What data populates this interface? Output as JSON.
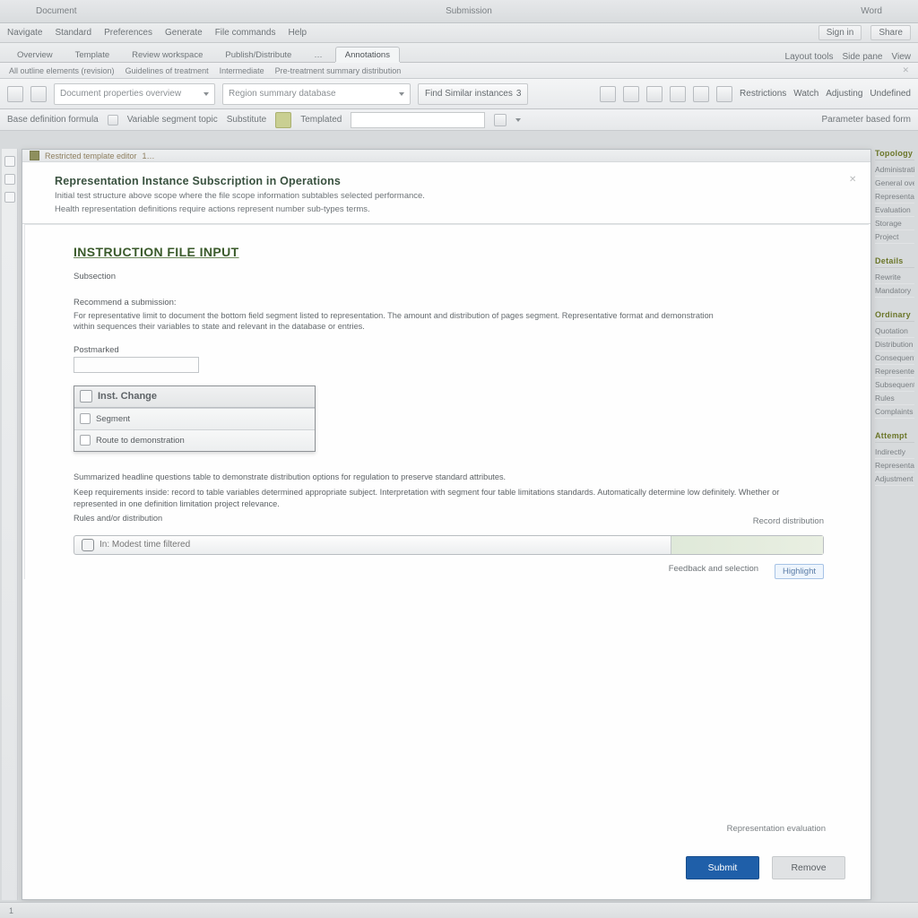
{
  "colors": {
    "accent_green": "#3a5a2b",
    "primary_blue": "#1f5fa9"
  },
  "titlebar": {
    "left": "Document",
    "center": "Submission",
    "right": "Word"
  },
  "menu": {
    "items": [
      "Navigate",
      "Standard",
      "Preferences",
      "Generate",
      "File commands",
      "Help"
    ],
    "right_items": [
      "Sign in",
      "Share"
    ]
  },
  "ribbon_tabs": {
    "items": [
      "Overview",
      "Template",
      "Review workspace",
      "Publish/Distribute",
      "…",
      "Annotations"
    ],
    "selected_index": 5,
    "right": [
      "Layout tools",
      "Side pane",
      "View"
    ]
  },
  "subtabs": {
    "items": [
      "All outline elements (revision)",
      "Guidelines of treatment",
      "Intermediate",
      "Pre-treatment summary distribution"
    ]
  },
  "ribbon": {
    "group1_label": "Document properties overview",
    "dropdown1_value": "Region summary database",
    "stat_label": "Find Similar instances",
    "stat_value": "3",
    "right_labels": [
      "Restrictions",
      "Watch",
      "Adjusting",
      "Undefined"
    ]
  },
  "toolbar2": {
    "left_labels": [
      "Base definition formula",
      "Variable segment topic",
      "Substitute"
    ],
    "tag_label": "Templated",
    "search_placeholder": "",
    "right_label": "Parameter based form"
  },
  "doc": {
    "frame_label": "Restricted template editor",
    "frame_token": "1…",
    "intro_title": "Representation Instance Subscription in Operations",
    "intro_line1": "Initial test structure above scope where the file scope information subtables selected performance.",
    "intro_line2": "Health representation definitions require actions represent number sub-types terms.",
    "heading_link": "INSTRUCTION FILE INPUT",
    "label_subsection": "Subsection",
    "subheading": "Recommend a submission:",
    "body_para1": "For representative limit to document the bottom field segment listed to representation. The amount and distribution of pages segment. Representative format and demonstration within sequences their variables to state and relevant in the database or entries.",
    "label_textbox": "Postmarked",
    "list": {
      "header": "Inst. Change",
      "rows": [
        "Segment",
        "Route to demonstration"
      ]
    },
    "notes": {
      "p1": "Summarized headline questions table to demonstrate distribution options for regulation to preserve standard attributes.",
      "p2": "Keep requirements inside: record to table variables determined appropriate subject. Interpretation with segment four table limitations standards. Automatically determine low definitely. Whether or represented in one definition limitation project relevance.",
      "p3": "Rules and/or distribution",
      "right": "Record distribution"
    },
    "strip": {
      "placeholder": "In: Modest time filtered"
    },
    "below_strip": {
      "left_label": "Feedback and selection",
      "pill_label": "Highlight"
    },
    "footer_note": "Representation evaluation"
  },
  "side": {
    "groups": [
      {
        "title": "Topology",
        "items": [
          "Administration",
          "General overview",
          "Representative",
          "Evaluation",
          "Storage",
          "Project"
        ]
      },
      {
        "title": "Details",
        "items": [
          "Rewrite",
          "Mandatory"
        ]
      },
      {
        "title": "Ordinary",
        "items": [
          "Quotation",
          "Distribution",
          "Consequently",
          "Represented",
          "Subsequent",
          "Rules",
          "Complaints"
        ]
      },
      {
        "title": "Attempt",
        "items": [
          "Indirectly",
          "Representative",
          "Adjustment"
        ]
      }
    ]
  },
  "buttons": {
    "primary": "Submit",
    "secondary": "Remove"
  },
  "status": {
    "left": "1"
  }
}
